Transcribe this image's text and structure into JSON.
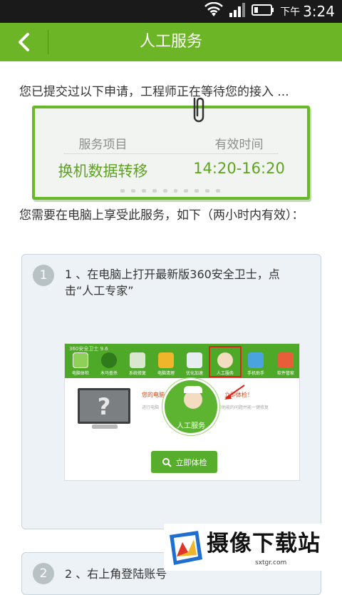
{
  "status_bar": {
    "time_prefix": "下午",
    "time": "3:24"
  },
  "header": {
    "title": "人工服务"
  },
  "intro": "您已提交过以下申请，工程师正在等待您的接入 ...",
  "request_card": {
    "col1_label": "服务项目",
    "col2_label": "有效时间",
    "service": "换机数据转移",
    "time_range": "14:20-16:20"
  },
  "instructions": "您需要在电脑上享受此服务，如下（两小时内有效）：",
  "step1": {
    "number": "1",
    "text": "1 、在电脑上打开最新版360安全卫士，点击“人工专家”"
  },
  "screenshot": {
    "app_title": "360安全卫士 9.6",
    "tools": [
      "电脑体检",
      "木马查杀",
      "系统修复",
      "电脑清理",
      "优化加速",
      "人工服务",
      "手机助手",
      "软件管家"
    ],
    "message": "您的电脑",
    "message_suffix": "立即体检！",
    "message_sub": "进行电脑",
    "message_sub_suffix": "和他能的问题并能一键修复",
    "service_label": "人工服务",
    "scan_button": "立即体检"
  },
  "step2": {
    "number": "2",
    "text": "2 、右上角登陆账号"
  },
  "watermark": {
    "text": "摄像下载站",
    "url": "sxtgr.com"
  },
  "colors": {
    "header_green": "#6cb526",
    "value_green": "#5ea320",
    "step_bg": "#edf2f6"
  }
}
